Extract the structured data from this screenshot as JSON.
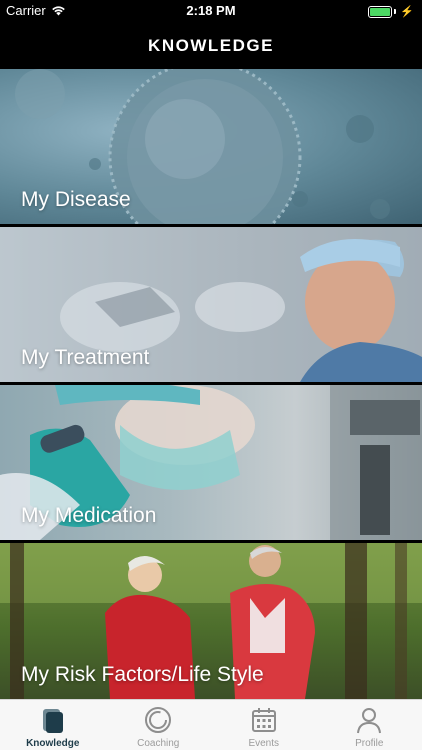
{
  "status_bar": {
    "carrier": "Carrier",
    "time": "2:18 PM"
  },
  "nav": {
    "title": "KNOWLEDGE"
  },
  "tiles": [
    {
      "label": "My Disease"
    },
    {
      "label": "My Treatment"
    },
    {
      "label": "My Medication"
    },
    {
      "label": "My Risk Factors/Life Style"
    }
  ],
  "tabbar": {
    "active_color": "#1e3c4a",
    "inactive_color": "#9b9b9b",
    "items": [
      {
        "label": "Knowledge",
        "icon": "knowledge-icon",
        "active": true
      },
      {
        "label": "Coaching",
        "icon": "coaching-icon",
        "active": false
      },
      {
        "label": "Events",
        "icon": "calendar-icon",
        "active": false
      },
      {
        "label": "Profile",
        "icon": "profile-icon",
        "active": false
      }
    ]
  }
}
